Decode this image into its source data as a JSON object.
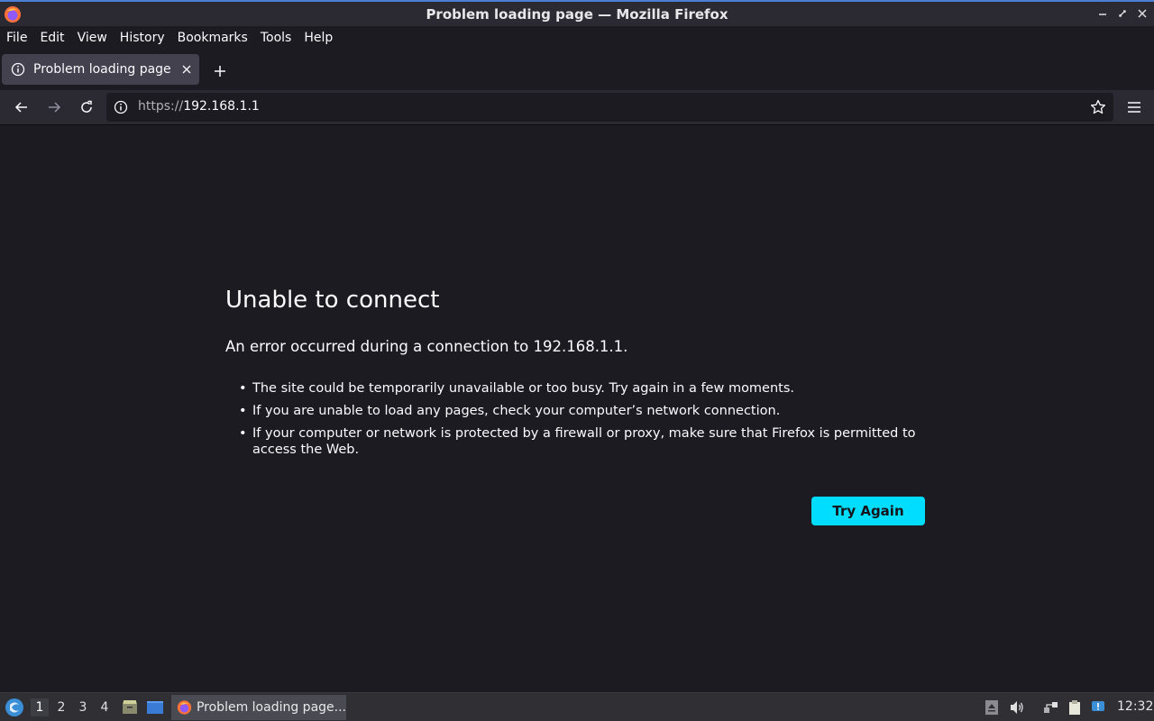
{
  "window": {
    "title": "Problem loading page — Mozilla Firefox",
    "app_icon": "firefox-icon",
    "controls": [
      "minimize-icon",
      "restore-icon",
      "close-icon"
    ]
  },
  "menubar": {
    "items": [
      {
        "label": "File"
      },
      {
        "label": "Edit"
      },
      {
        "label": "View"
      },
      {
        "label": "History"
      },
      {
        "label": "Bookmarks"
      },
      {
        "label": "Tools"
      },
      {
        "label": "Help"
      }
    ]
  },
  "tabs": {
    "active": {
      "label": "Problem loading page",
      "icon": "info-icon"
    },
    "new_tab_icon": "plus-icon"
  },
  "navbar": {
    "url_scheme": "https://",
    "url_host": "192.168.1.1",
    "icons": [
      "back-icon",
      "forward-icon",
      "reload-icon",
      "info-icon",
      "star-icon",
      "hamburger-menu-icon"
    ]
  },
  "error_page": {
    "title": "Unable to connect",
    "description": "An error occurred during a connection to 192.168.1.1.",
    "bullets": [
      "The site could be temporarily unavailable or too busy. Try again in a few moments.",
      "If you are unable to load any pages, check your computer’s network connection.",
      "If your computer or network is protected by a firewall or proxy, make sure that Firefox is permitted to access the Web."
    ],
    "try_again_label": "Try Again"
  },
  "taskbar": {
    "workspaces": [
      "1",
      "2",
      "3",
      "4"
    ],
    "active_workspace": "1",
    "task_label": "Problem loading page...",
    "clock": "12:32"
  },
  "colors": {
    "background": "#1c1b22",
    "toolbar": "#2b2a33",
    "accent": "#00ddff",
    "tab_active": "#42414d"
  }
}
